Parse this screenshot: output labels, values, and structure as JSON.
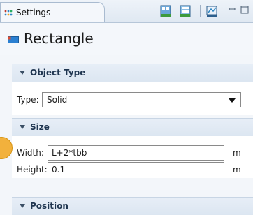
{
  "tab": {
    "label": "Settings",
    "icon": "settings-tree-icon"
  },
  "toolbar": {
    "icons": [
      "build-selected-icon",
      "build-all-icon",
      "plot-icon"
    ],
    "window_buttons": [
      "minimize-icon",
      "maximize-icon"
    ]
  },
  "header": {
    "title": "Rectangle",
    "icon": "rectangle-icon"
  },
  "sections": {
    "object_type": {
      "title": "Object Type",
      "type_label": "Type:",
      "type_value": "Solid"
    },
    "size": {
      "title": "Size",
      "width_label": "Width:",
      "width_value": "L+2*tbb",
      "width_unit": "m",
      "height_label": "Height:",
      "height_value": "0.1",
      "height_unit": "m"
    },
    "position": {
      "title": "Position"
    }
  },
  "colors": {
    "accent_dot": "#f2b13c",
    "section_title": "#1f3550",
    "rectangle_icon": "#2a7fd1"
  }
}
